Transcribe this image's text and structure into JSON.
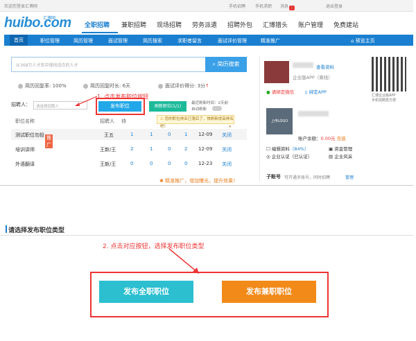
{
  "topbar": {
    "welcome": "欢迎您登录汇博网",
    "mobile_recruit": "手机招聘",
    "mobile_job": "手机求职",
    "messages": "消息",
    "msg_count": "1",
    "logout": "退出登录"
  },
  "logo": {
    "text": "huibo.com",
    "sub": "汇博网"
  },
  "nav": [
    "全职招聘",
    "兼职招聘",
    "现场招聘",
    "劳务派遣",
    "招聘外包",
    "汇博猎头",
    "账户管理",
    "免费建站"
  ],
  "subnav": {
    "items": [
      "首页",
      "职位管理",
      "简历管理",
      "面试管理",
      "简历搜索",
      "求职者留言",
      "面试评价管理",
      "精准推广"
    ],
    "preview": "预览主页"
  },
  "search": {
    "placeholder": "从368万人才库中搜找适合的人才",
    "button": "简历搜索"
  },
  "stats": {
    "reply_rate": "简历回复率: 100%",
    "reply_time": "简历回复时长: 6天",
    "score": "面试评价得分: 3分"
  },
  "recruiter": {
    "label": "招聘人：",
    "placeholder": "请选择招聘人"
  },
  "annotation1": "1. 点击发布职位按钮",
  "buttons": {
    "post": "发布职位",
    "refresh": "刷新职位(1/1)"
  },
  "refresh_info": {
    "line1": "最近刷新时间：2天前",
    "line2": "自动刷新"
  },
  "tip": "您的职位排名已落后了，快刷新提高排名吧！",
  "table": {
    "headers": [
      "职位名称",
      "招聘人",
      "待"
    ],
    "rows": [
      {
        "name": "测试职位勿投",
        "tag": "推广",
        "recruiter": "王五",
        "c1": "1",
        "c2": "1",
        "c3": "0",
        "c4": "1",
        "date": "12-09",
        "action": "关闭"
      },
      {
        "name": "培训讲师",
        "tag": "",
        "recruiter": "王新/王",
        "c1": "2",
        "c2": "1",
        "c3": "0",
        "c4": "2",
        "date": "12-09",
        "action": "关闭"
      },
      {
        "name": "外语翻译",
        "tag": "",
        "recruiter": "王新/王",
        "c1": "0",
        "c2": "0",
        "c3": "0",
        "c4": "0",
        "date": "12-23",
        "action": "关闭"
      }
    ]
  },
  "promo": "精准推广，增加曝光，提升效果！",
  "side": {
    "view_profile": "查看资料",
    "app_label": "企业版APP（离线）",
    "bind_wechat": "请绑定微信",
    "bind_app": "绑定APP",
    "qr_caption1": "汇博企业版APP",
    "qr_caption2": "手机招聘更方便",
    "logo_upload": "上传LOGO",
    "balance_label": "账户余额：",
    "balance": "0.00元",
    "recharge": "充值",
    "edit_profile": "编辑资料",
    "profile_pct": "（84%）",
    "fund_manage": "资金管理",
    "cert": "企业认证（已认证）",
    "risk": "企业风采",
    "subaccount": "子账号",
    "subaccount_desc": "可开通多账号，同时招聘",
    "manage": "管理"
  },
  "lower": {
    "title": "请选择发布职位类型",
    "annotation2": "2. 点击对应按钮，选择发布职位类型",
    "btn_full": "发布全职职位",
    "btn_part": "发布兼职职位"
  },
  "colors": {
    "brand": "#1a7fd0",
    "red": "#ee3333",
    "teal": "#2bbfd0",
    "orange": "#f28a1a"
  }
}
